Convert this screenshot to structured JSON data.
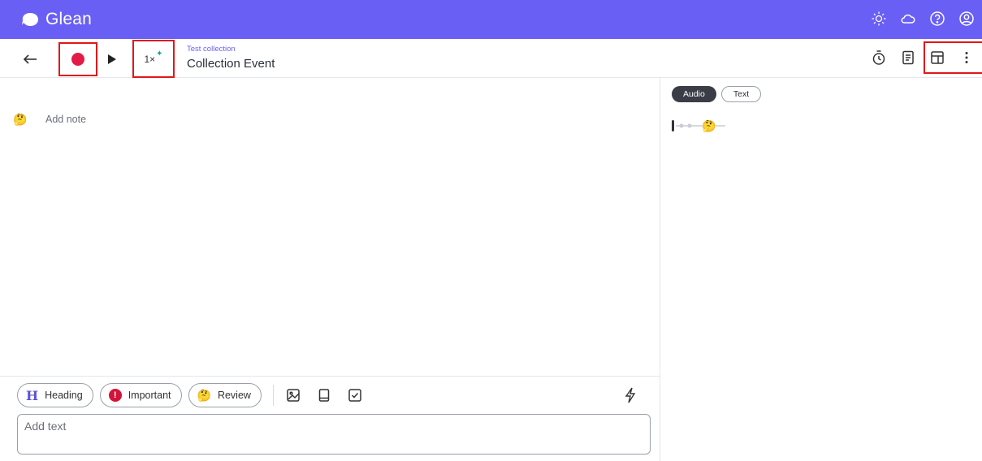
{
  "app": {
    "name": "Glean"
  },
  "topbar": {
    "icons": [
      "sun-icon",
      "cloud-icon",
      "help-icon",
      "account-icon"
    ]
  },
  "toolbar": {
    "back_icon": "arrow-left-icon",
    "record_icon": "record-icon",
    "play_icon": "play-icon",
    "speed_label": "1×",
    "speed_sparkle": "✦",
    "breadcrumb": "Test collection",
    "title": "Collection Event",
    "right_icons": [
      "timer-icon",
      "document-icon",
      "layout-icon",
      "more-vertical-icon"
    ]
  },
  "notes": {
    "add_note_label": "Add note",
    "emoji": "🤔"
  },
  "bottom": {
    "chips": [
      {
        "glyph": "H",
        "label": "Heading"
      },
      {
        "glyph": "!",
        "label": "Important"
      },
      {
        "glyph": "🤔",
        "label": "Review"
      }
    ],
    "tools": [
      "image-icon",
      "book-icon",
      "checkbox-icon"
    ],
    "bolt_icon": "lightning-icon",
    "text_placeholder": "Add text"
  },
  "side": {
    "tabs": [
      {
        "label": "Audio",
        "active": true
      },
      {
        "label": "Text",
        "active": false
      }
    ],
    "timeline_emoji": "🤔"
  },
  "colors": {
    "brand": "#6a5ff5",
    "record": "#e31b47",
    "important": "#d2143a",
    "highlight": "#e01818"
  }
}
